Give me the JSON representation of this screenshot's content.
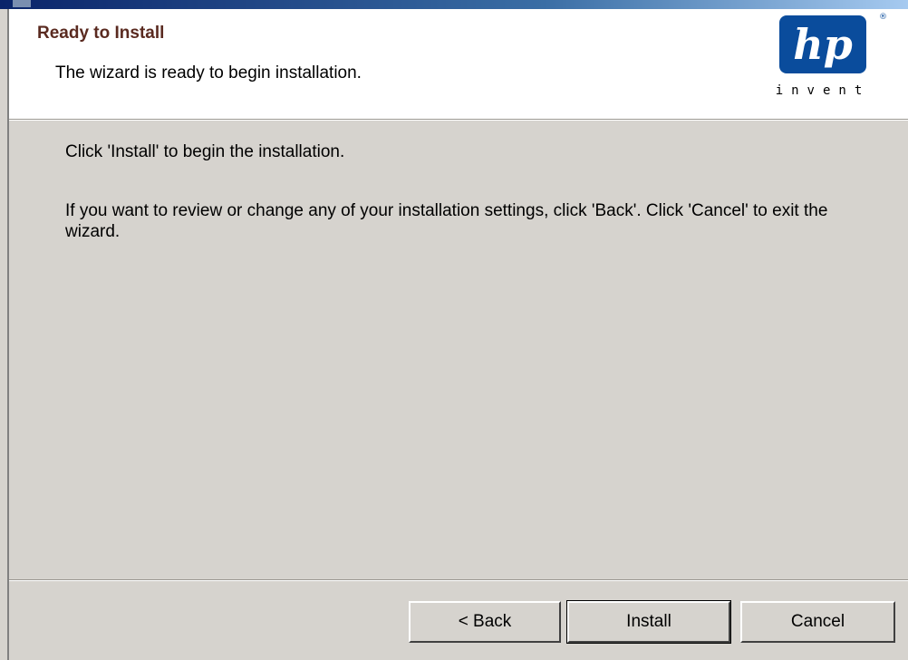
{
  "header": {
    "title": "Ready to Install",
    "subtitle": "The wizard is ready to begin installation."
  },
  "logo": {
    "brand_text": "hp",
    "tagline": "invent",
    "brand_color": "#0a4c9c"
  },
  "body": {
    "line1": "Click 'Install' to begin the installation.",
    "line2": "If you want to review or change any of your installation settings, click 'Back'. Click 'Cancel' to exit the wizard."
  },
  "buttons": {
    "back_label": "< Back",
    "install_label": "Install",
    "cancel_label": "Cancel"
  }
}
